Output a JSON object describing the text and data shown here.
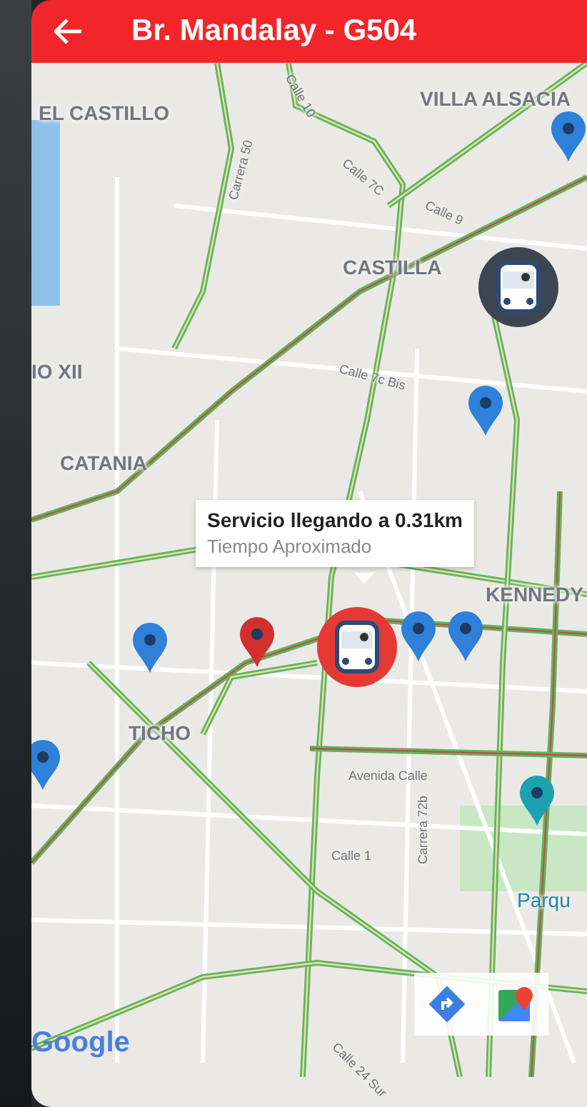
{
  "header": {
    "title": "Br. Mandalay - G504"
  },
  "map": {
    "labels": [
      {
        "text": "EL CASTILLO",
        "kind": "area"
      },
      {
        "text": "VILLA ALSACIA",
        "kind": "area"
      },
      {
        "text": "CASTILLA",
        "kind": "area"
      },
      {
        "text": "IO XII",
        "kind": "area"
      },
      {
        "text": "CATANIA",
        "kind": "area"
      },
      {
        "text": "KENNEDY",
        "kind": "area"
      },
      {
        "text": "TICHO",
        "kind": "area"
      },
      {
        "text": "Parqu",
        "kind": "park"
      },
      {
        "text": "Calle 10",
        "kind": "street"
      },
      {
        "text": "Carrera 50",
        "kind": "street"
      },
      {
        "text": "Calle 9",
        "kind": "street"
      },
      {
        "text": "Calle 7C",
        "kind": "street"
      },
      {
        "text": "Calle 7c Bis",
        "kind": "street"
      },
      {
        "text": "Avenida Calle",
        "kind": "street"
      },
      {
        "text": "Calle 1",
        "kind": "street"
      },
      {
        "text": "Carrera 72b",
        "kind": "street"
      },
      {
        "text": "Calle 24 Sur",
        "kind": "street"
      }
    ],
    "markers": [
      {
        "kind": "pin",
        "color": "#2f80d8"
      },
      {
        "kind": "bus",
        "color": "#3d4550"
      },
      {
        "kind": "pin",
        "color": "#2f80d8"
      },
      {
        "kind": "pin",
        "color": "#2f80d8"
      },
      {
        "kind": "bus",
        "color": "#e53935"
      },
      {
        "kind": "pin",
        "color": "#2f80d8"
      },
      {
        "kind": "pin",
        "color": "#2f80d8"
      },
      {
        "kind": "pin",
        "color": "#d32f2f"
      },
      {
        "kind": "pin",
        "color": "#2f80d8"
      },
      {
        "kind": "pin",
        "color": "#1ba2b0"
      }
    ],
    "info_window": {
      "title": "Servicio llegando a 0.31km",
      "subtitle": "Tiempo Aproximado"
    },
    "logo": "Google"
  }
}
